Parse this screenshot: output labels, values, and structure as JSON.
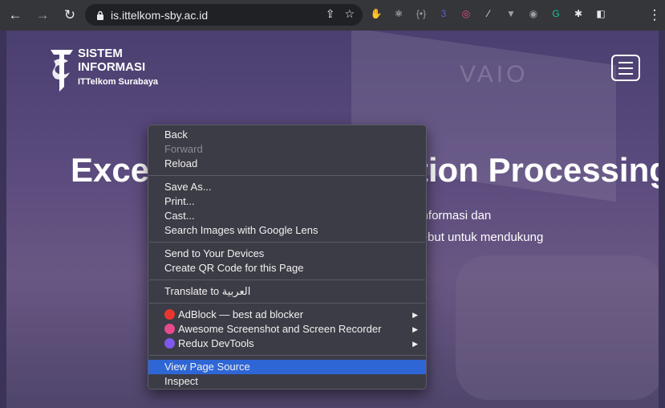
{
  "browser": {
    "url": "is.ittelkom-sby.ac.id",
    "extensions": [
      {
        "name": "adblock-icon",
        "glyph": "✋",
        "color": "#e8372f"
      },
      {
        "name": "react-devtools-icon",
        "glyph": "⚛",
        "color": "#e8eaed"
      },
      {
        "name": "json-icon",
        "glyph": "{•}",
        "color": "#9aa0a6"
      },
      {
        "name": "extension-badge-icon",
        "glyph": "3",
        "color": "#5b5fc7"
      },
      {
        "name": "screenshot-icon",
        "glyph": "◎",
        "color": "#e54b8a"
      },
      {
        "name": "pen-icon",
        "glyph": "⁄",
        "color": "#e8eaed"
      },
      {
        "name": "vue-devtools-icon",
        "glyph": "▼",
        "color": "#9aa0a6"
      },
      {
        "name": "redux-devtools-icon",
        "glyph": "◉",
        "color": "#9aa0a6"
      },
      {
        "name": "grammarly-icon",
        "glyph": "G",
        "color": "#15c39a"
      },
      {
        "name": "extensions-puzzle-icon",
        "glyph": "✱",
        "color": "#e8eaed"
      },
      {
        "name": "side-panel-icon",
        "glyph": "◧",
        "color": "#e8eaed"
      }
    ]
  },
  "site": {
    "logo": {
      "line1": "SISTEM",
      "line2": "INFORMASI",
      "line3": "ITTelkom Surabaya"
    },
    "hero_title": "Excellence in Information Processing Systems",
    "hero_line1": "Mengintegrasikan keunggulan teknologi informasi dan",
    "hero_line2": "aktivitas bisnis yang terhubung dengan sistem tersebut untuk mendukung"
  },
  "context_menu": {
    "groups": [
      [
        {
          "label": "Back"
        },
        {
          "label": "Forward",
          "disabled": true
        },
        {
          "label": "Reload"
        }
      ],
      [
        {
          "label": "Save As..."
        },
        {
          "label": "Print..."
        },
        {
          "label": "Cast..."
        },
        {
          "label": "Search Images with Google Lens"
        }
      ],
      [
        {
          "label": "Send to Your Devices"
        },
        {
          "label": "Create QR Code for this Page"
        }
      ],
      [
        {
          "label": "Translate to العربية"
        }
      ],
      [
        {
          "label": "AdBlock — best ad blocker",
          "icon": "adblock-icon",
          "icon_color": "#e8372f",
          "submenu": true
        },
        {
          "label": "Awesome Screenshot and Screen Recorder",
          "icon": "awesome-screenshot-icon",
          "icon_color": "#e54b8a",
          "submenu": true
        },
        {
          "label": "Redux DevTools",
          "icon": "redux-devtools-icon",
          "icon_color": "#7f58ee",
          "submenu": true
        }
      ],
      [
        {
          "label": "View Page Source",
          "selected": true
        },
        {
          "label": "Inspect"
        }
      ]
    ]
  }
}
